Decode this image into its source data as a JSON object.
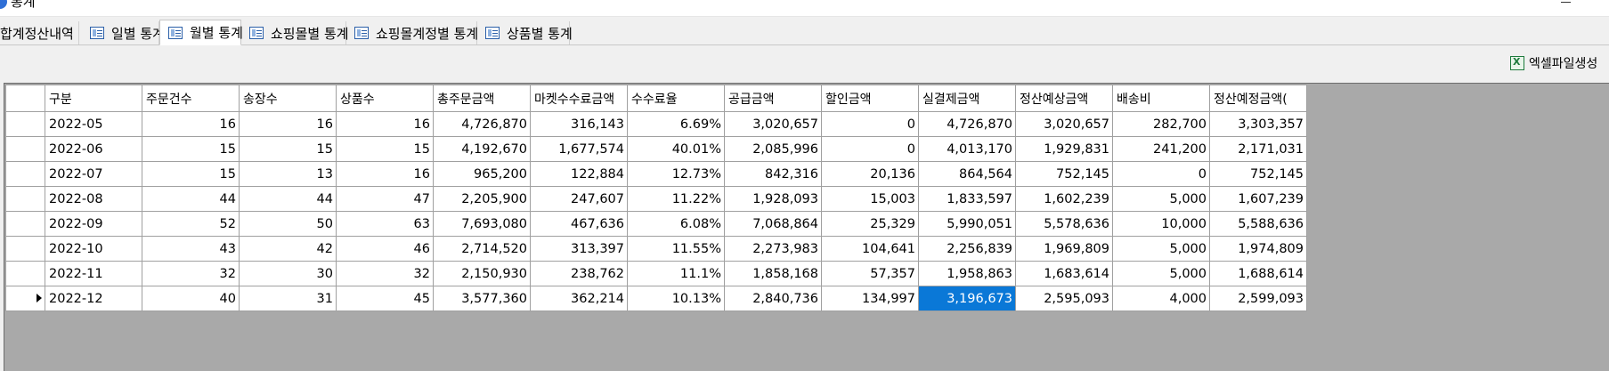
{
  "window": {
    "title": "통계"
  },
  "tabs": [
    {
      "label": "합계정산내역",
      "active": false
    },
    {
      "label": "일별 통계",
      "active": false
    },
    {
      "label": "월별 통계",
      "active": true
    },
    {
      "label": "쇼핑몰별 통계",
      "active": false
    },
    {
      "label": "쇼핑몰계정별 통계",
      "active": false
    },
    {
      "label": "상품별 통계",
      "active": false
    }
  ],
  "toolbar": {
    "excel_label": "엑셀파일생성"
  },
  "grid": {
    "columns": [
      "구분",
      "주문건수",
      "송장수",
      "상품수",
      "총주문금액",
      "마켓수수료금액",
      "수수료율",
      "공급금액",
      "할인금액",
      "실결제금액",
      "정산예상금액",
      "배송비",
      "정산예정금액("
    ],
    "rows": [
      [
        "2022-05",
        "16",
        "16",
        "16",
        "4,726,870",
        "316,143",
        "6.69%",
        "3,020,657",
        "0",
        "4,726,870",
        "3,020,657",
        "282,700",
        "3,303,357"
      ],
      [
        "2022-06",
        "15",
        "15",
        "15",
        "4,192,670",
        "1,677,574",
        "40.01%",
        "2,085,996",
        "0",
        "4,013,170",
        "1,929,831",
        "241,200",
        "2,171,031"
      ],
      [
        "2022-07",
        "15",
        "13",
        "16",
        "965,200",
        "122,884",
        "12.73%",
        "842,316",
        "20,136",
        "864,564",
        "752,145",
        "0",
        "752,145"
      ],
      [
        "2022-08",
        "44",
        "44",
        "47",
        "2,205,900",
        "247,607",
        "11.22%",
        "1,928,093",
        "15,003",
        "1,833,597",
        "1,602,239",
        "5,000",
        "1,607,239"
      ],
      [
        "2022-09",
        "52",
        "50",
        "63",
        "7,693,080",
        "467,636",
        "6.08%",
        "7,068,864",
        "25,329",
        "5,990,051",
        "5,578,636",
        "10,000",
        "5,588,636"
      ],
      [
        "2022-10",
        "43",
        "42",
        "46",
        "2,714,520",
        "313,397",
        "11.55%",
        "2,273,983",
        "104,641",
        "2,256,839",
        "1,969,809",
        "5,000",
        "1,974,809"
      ],
      [
        "2022-11",
        "32",
        "30",
        "32",
        "2,150,930",
        "238,762",
        "11.1%",
        "1,858,168",
        "57,357",
        "1,958,863",
        "1,683,614",
        "5,000",
        "1,688,614"
      ],
      [
        "2022-12",
        "40",
        "31",
        "45",
        "3,577,360",
        "362,214",
        "10.13%",
        "2,840,736",
        "134,997",
        "3,196,673",
        "2,595,093",
        "4,000",
        "2,599,093"
      ]
    ],
    "current_row": 7,
    "selected_cell_column": 9,
    "selection_color": "#0a78d7"
  }
}
